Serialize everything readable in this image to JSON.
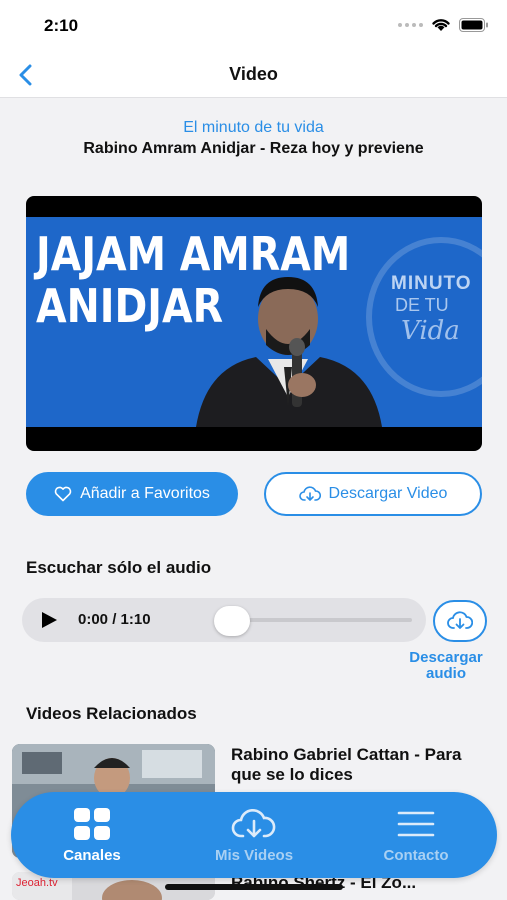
{
  "status_bar": {
    "time": "2:10"
  },
  "nav": {
    "title": "Video"
  },
  "video": {
    "channel": "El minuto de tu vida",
    "title": "Rabino Amram Anidjar - Reza hoy y previene",
    "thumbnail": {
      "line1": "JAJAM AMRAM",
      "line2": "ANIDJAR",
      "logo_line1": "MINUTO",
      "logo_line2": "DE TU",
      "logo_line3": "Vida"
    }
  },
  "actions": {
    "favorite_label": "Añadir a Favoritos",
    "download_video_label": "Descargar Video"
  },
  "audio": {
    "heading": "Escuchar sólo el audio",
    "time": "0:00 / 1:10",
    "progress": 0,
    "download_label": "Descargar audio"
  },
  "related": {
    "heading": "Videos Relacionados",
    "items": [
      {
        "title": "Rabino Gabriel Cattan - Para que se lo dices"
      },
      {
        "title": "Rabino Shertz - El Zo..."
      }
    ]
  },
  "tab_bar": {
    "tabs": [
      {
        "label": "Canales",
        "icon": "grid-icon",
        "active": true
      },
      {
        "label": "Mis Videos",
        "icon": "cloud-download-icon",
        "active": false
      },
      {
        "label": "Contacto",
        "icon": "menu-icon",
        "active": false
      }
    ]
  },
  "colors": {
    "accent": "#2a8ee6",
    "background": "#f2f2f4",
    "thumbnail_blue": "#1e67c9"
  }
}
